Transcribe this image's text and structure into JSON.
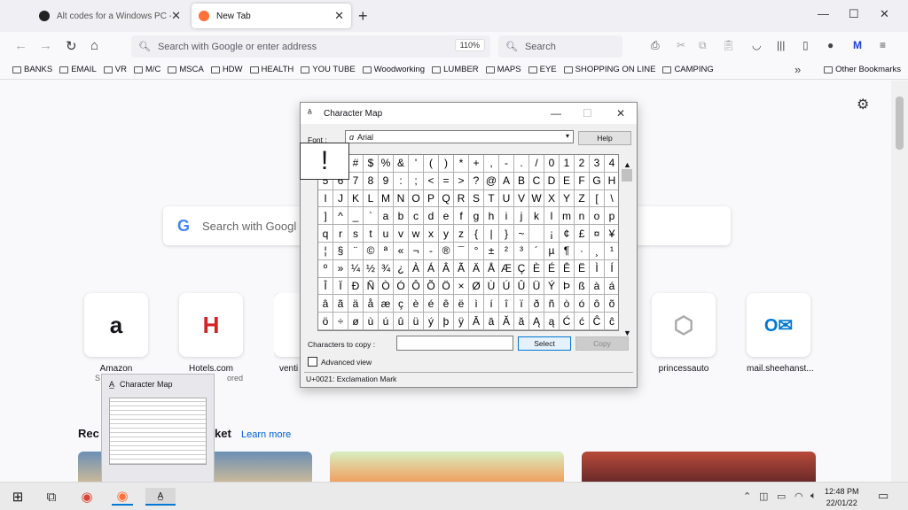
{
  "tabs": [
    {
      "title": "Alt codes for a Windows PC - W",
      "close": "✕"
    },
    {
      "title": "New Tab",
      "close": "✕"
    }
  ],
  "new_tab": "+",
  "window_controls": {
    "min": "—",
    "max": "☐",
    "close": "✕"
  },
  "nav": {
    "back": "←",
    "forward": "→",
    "reload": "↻",
    "home": "⌂",
    "url_placeholder": "Search with Google or enter address",
    "zoom": "110%",
    "search_placeholder": "Search"
  },
  "bookmarks": [
    "BANKS",
    "EMAIL",
    "VR",
    "M/C",
    "MSCA",
    "HDW",
    "HEALTH",
    "YOU TUBE",
    "Woodworking",
    "LUMBER",
    "MAPS",
    "EYE",
    "SHOPPING ON LINE",
    "CAMPING"
  ],
  "bookmarks_overflow": "»",
  "other_bookmarks": "Other Bookmarks",
  "newtab_page": {
    "search_placeholder": "Search with Googl",
    "top_sites": [
      {
        "label": "Amazon",
        "sub": "S"
      },
      {
        "label": "Hotels.com",
        "sub": "ored"
      },
      {
        "label": "venti",
        "sub": ""
      },
      {
        "label": "princessauto",
        "sub": ""
      },
      {
        "label": "mail.sheehanst...",
        "sub": ""
      }
    ],
    "recent_title_start": "Rec",
    "recent_title_end": "ket",
    "learn_more": "Learn more"
  },
  "charmap": {
    "title": "Character Map",
    "font_label": "Font :",
    "font_value": "Arial",
    "help": "Help",
    "zoomed_char": "!",
    "chars_to_copy_label": "Characters to copy :",
    "select": "Select",
    "copy": "Copy",
    "advanced_view": "Advanced view",
    "status": "U+0021: Exclamation Mark",
    "rows": [
      [
        "!",
        "\"",
        "#",
        "$",
        "%",
        "&",
        "'",
        "(",
        ")",
        "*",
        "+",
        ",",
        "-",
        ".",
        "/",
        "0",
        "1",
        "2",
        "3",
        "4"
      ],
      [
        "5",
        "6",
        "7",
        "8",
        "9",
        ":",
        ";",
        "<",
        "=",
        ">",
        "?",
        "@",
        "A",
        "B",
        "C",
        "D",
        "E",
        "F",
        "G",
        "H"
      ],
      [
        "I",
        "J",
        "K",
        "L",
        "M",
        "N",
        "O",
        "P",
        "Q",
        "R",
        "S",
        "T",
        "U",
        "V",
        "W",
        "X",
        "Y",
        "Z",
        "[",
        "\\"
      ],
      [
        "]",
        "^",
        "_",
        "`",
        "a",
        "b",
        "c",
        "d",
        "e",
        "f",
        "g",
        "h",
        "i",
        "j",
        "k",
        "l",
        "m",
        "n",
        "o",
        "p"
      ],
      [
        "q",
        "r",
        "s",
        "t",
        "u",
        "v",
        "w",
        "x",
        "y",
        "z",
        "{",
        "|",
        "}",
        "~",
        " ",
        "¡",
        "¢",
        "£",
        "¤",
        "¥"
      ],
      [
        "¦",
        "§",
        "¨",
        "©",
        "ª",
        "«",
        "¬",
        "-",
        "®",
        "¯",
        "°",
        "±",
        "²",
        "³",
        "´",
        "µ",
        "¶",
        "·",
        "¸",
        "¹"
      ],
      [
        "º",
        "»",
        "¼",
        "½",
        "¾",
        "¿",
        "À",
        "Á",
        "Â",
        "Ã",
        "Ä",
        "Å",
        "Æ",
        "Ç",
        "È",
        "É",
        "Ê",
        "Ë",
        "Ì",
        "Í"
      ],
      [
        "Î",
        "Ï",
        "Ð",
        "Ñ",
        "Ò",
        "Ó",
        "Ô",
        "Õ",
        "Ö",
        "×",
        "Ø",
        "Ù",
        "Ú",
        "Û",
        "Ü",
        "Ý",
        "Þ",
        "ß",
        "à",
        "á"
      ],
      [
        "â",
        "ã",
        "ä",
        "å",
        "æ",
        "ç",
        "è",
        "é",
        "ê",
        "ë",
        "ì",
        "í",
        "î",
        "ï",
        "ð",
        "ñ",
        "ò",
        "ó",
        "ô",
        "õ"
      ],
      [
        "ö",
        "÷",
        "ø",
        "ù",
        "ú",
        "û",
        "ü",
        "ý",
        "þ",
        "ÿ",
        "Ā",
        "ā",
        "Ă",
        "ă",
        "Ą",
        "ą",
        "Ć",
        "ć",
        "Ĉ",
        "ĉ"
      ]
    ]
  },
  "thumb_preview_title": "Character Map",
  "clock": {
    "time": "12:48 PM",
    "date": "22/01/22"
  }
}
